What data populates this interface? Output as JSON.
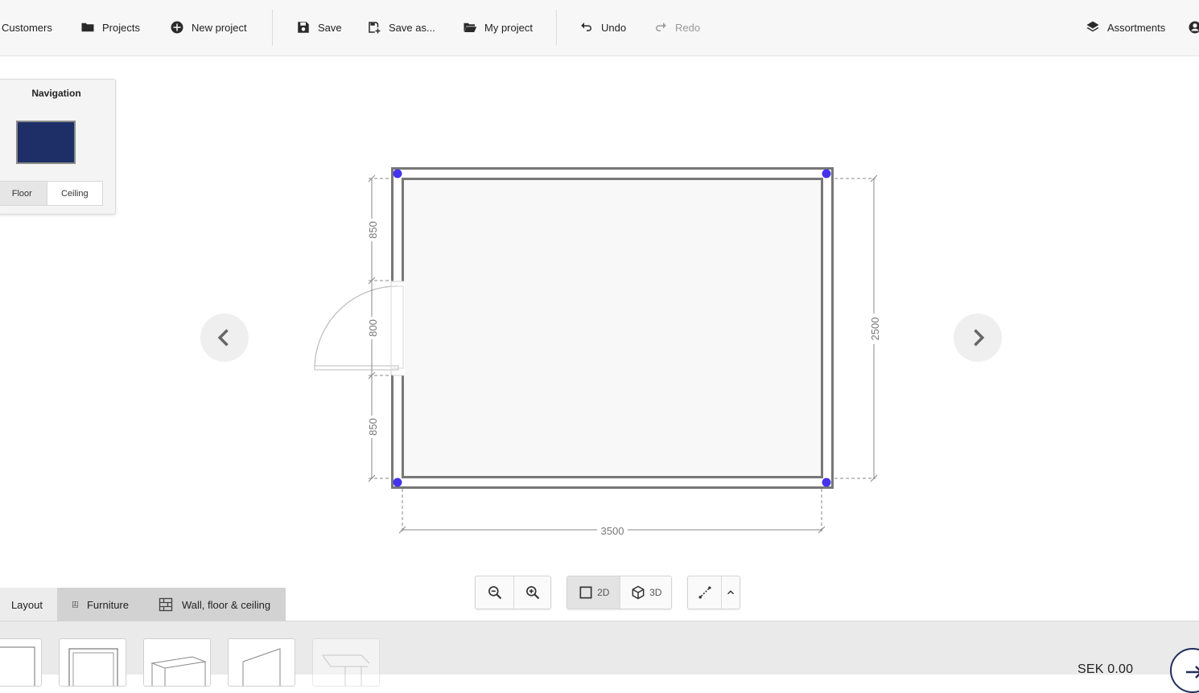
{
  "toolbar": {
    "customers": "Customers",
    "projects": "Projects",
    "new_project": "New project",
    "save": "Save",
    "save_as": "Save as...",
    "my_project": "My project",
    "undo": "Undo",
    "redo": "Redo",
    "assortments": "Assortments"
  },
  "navigation": {
    "title": "Navigation",
    "tabs": [
      "Floor",
      "Ceiling"
    ],
    "active_tab": "Floor",
    "thumbnail_color": "#1d2f66"
  },
  "floorplan": {
    "dimensions": {
      "left_top": "850",
      "door": "800",
      "left_bottom": "850",
      "right": "2500",
      "bottom": "3500"
    },
    "handle_color": "#4433ee"
  },
  "view_controls": {
    "mode_2d": "2D",
    "mode_3d": "3D",
    "active_mode": "2D"
  },
  "bottom_tabs": {
    "layout": "Layout",
    "furniture": "Furniture",
    "wall_floor_ceiling": "Wall, floor & ceiling",
    "active": "Layout"
  },
  "footer": {
    "price": "SEK  0.00"
  }
}
